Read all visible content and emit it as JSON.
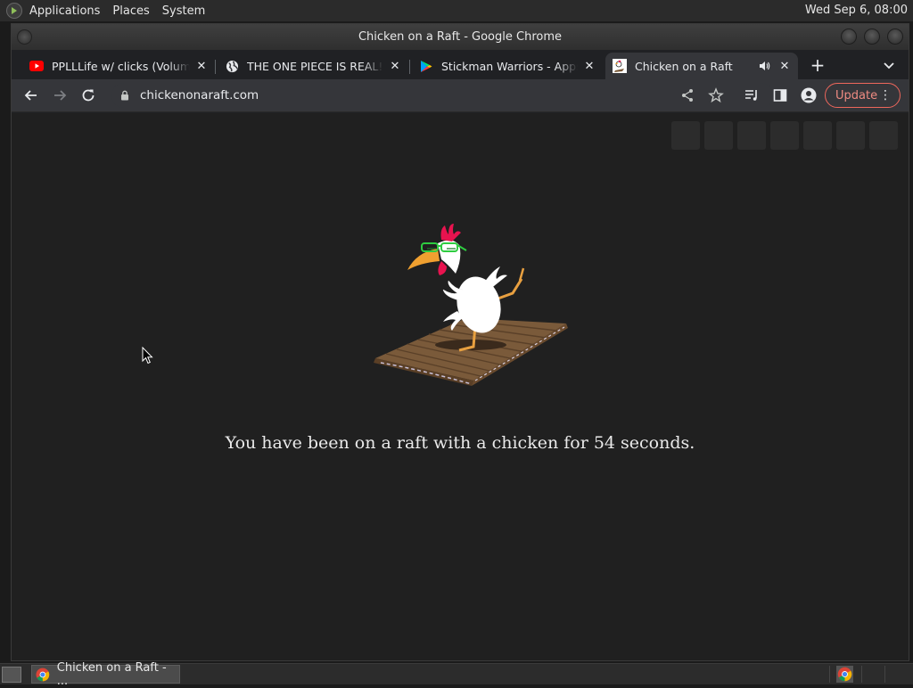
{
  "top_panel": {
    "menus": [
      "Applications",
      "Places",
      "System"
    ],
    "clock": "Wed Sep  6, 08:00"
  },
  "window": {
    "title": "Chicken on a Raft - Google Chrome"
  },
  "tabs": [
    {
      "title": "PPLLLife w/ clicks (Volume",
      "favicon": "youtube-icon",
      "active": false
    },
    {
      "title": "THE ONE PIECE IS REAL! (",
      "favicon": "globe-icon",
      "active": false
    },
    {
      "title": "Stickman Warriors - Apps",
      "favicon": "google-play-icon",
      "active": false
    },
    {
      "title": "Chicken on a Raft",
      "favicon": "chicken-favicon",
      "active": true,
      "audio": "speaker-icon"
    }
  ],
  "toolbar": {
    "url": "chickenonaraft.com",
    "update_label": "Update"
  },
  "page": {
    "message": "You have been on a raft with a chicken for 54 seconds.",
    "social_icons": [
      "facebook-icon",
      "twitter-icon",
      "tumblr-icon",
      "steam-icon",
      "reddit-icon",
      "paypal-icon",
      "extra-icon"
    ]
  },
  "taskbar": {
    "items": [
      {
        "label": "Chicken on a Raft - ...",
        "icon": "chrome-icon"
      }
    ]
  },
  "colors": {
    "page_background": "#202020",
    "update_accent": "#ee675c",
    "raft": "#7a5a3a",
    "comb": "#e8134f",
    "beak": "#f0a030",
    "glasses": "#2ecc40"
  }
}
